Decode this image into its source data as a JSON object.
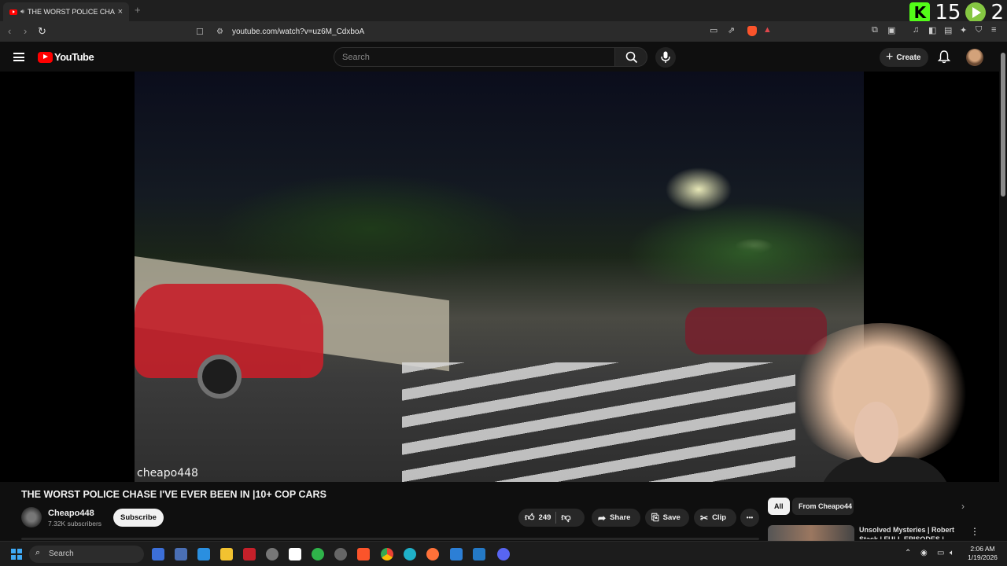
{
  "browser": {
    "tab_title": "THE WORST POLICE CHASE I'",
    "tab_close": "×",
    "new_tab": "+",
    "url": "youtube.com/watch?v=uz6M_CdxboA"
  },
  "stream_overlay": {
    "kick_letter": "K",
    "kick_count": "15",
    "rumble_count": "2"
  },
  "youtube": {
    "logo_text": "YouTube",
    "search_placeholder": "Search",
    "create_label": "Create"
  },
  "video": {
    "watermark": "cheapo448",
    "title": "THE WORST POLICE CHASE I'VE EVER BEEN IN |10+ COP CARS",
    "channel_name": "Cheapo448",
    "subscribers": "7.32K subscribers",
    "subscribe_label": "Subscribe",
    "likes": "249",
    "share_label": "Share",
    "save_label": "Save",
    "clip_label": "Clip",
    "more_label": "•••"
  },
  "sidebar": {
    "chips": [
      "All",
      "From Cheapo44"
    ],
    "recommendation_title": "Unsolved Mysteries | Robert Stack | FULL EPISODES |"
  },
  "taskbar": {
    "search_label": "Search",
    "time": "2:06 AM",
    "date": "1/19/2026"
  },
  "colors": {
    "youtube_red": "#ff0000",
    "kick_green": "#53fc18",
    "rumble_green": "#85c742",
    "page_bg": "#0f0f0f"
  }
}
